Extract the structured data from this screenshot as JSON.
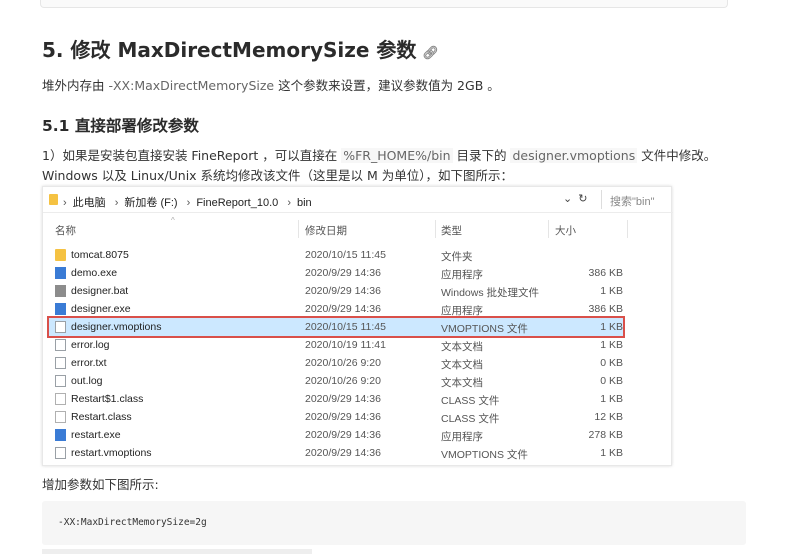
{
  "section": {
    "heading": "5. 修改 MaxDirectMemorySize 参数",
    "anchor_icon": "link-icon",
    "desc_prefix": "堆外内存由 ",
    "desc_code": "-XX:MaxDirectMemorySize",
    "desc_suffix": " 这个参数来设置，建议参数值为 2GB 。"
  },
  "subsection": {
    "heading": "5.1 直接部署修改参数",
    "para_1": "1）如果是安装包直接安装 FineReport ，可以直接在 ",
    "code_1": "%FR_HOME%/bin",
    "para_2": " 目录下的 ",
    "code_2": "designer.vmoptions",
    "para_3": " 文件中修改。Windows 以及 Linux/Unix 系统均修改该文件（这里是以 M 为单位），如下图所示："
  },
  "explorer": {
    "breadcrumb": [
      "此电脑",
      "新加卷 (F:)",
      "FineReport_10.0",
      "bin"
    ],
    "dropdown_icon": "chevron-down-icon",
    "refresh_icon": "refresh-icon",
    "search_placeholder": "搜索\"bin\"",
    "columns": {
      "name": "名称",
      "date": "修改日期",
      "type": "类型",
      "size": "大小"
    },
    "files": [
      {
        "name": "tomcat.8075",
        "date": "2020/10/15 11:45",
        "type": "文件夹",
        "size": "",
        "icon": "folder-icon"
      },
      {
        "name": "demo.exe",
        "date": "2020/9/29 14:36",
        "type": "应用程序",
        "size": "386 KB",
        "icon": "exe-icon"
      },
      {
        "name": "designer.bat",
        "date": "2020/9/29 14:36",
        "type": "Windows 批处理文件",
        "size": "1 KB",
        "icon": "bat-icon"
      },
      {
        "name": "designer.exe",
        "date": "2020/9/29 14:36",
        "type": "应用程序",
        "size": "386 KB",
        "icon": "exe-icon"
      },
      {
        "name": "designer.vmoptions",
        "date": "2020/10/15 11:45",
        "type": "VMOPTIONS 文件",
        "size": "1 KB",
        "icon": "document-icon",
        "selected": true
      },
      {
        "name": "error.log",
        "date": "2020/10/19 11:41",
        "type": "文本文档",
        "size": "1 KB",
        "icon": "document-icon"
      },
      {
        "name": "error.txt",
        "date": "2020/10/26 9:20",
        "type": "文本文档",
        "size": "0 KB",
        "icon": "document-icon"
      },
      {
        "name": "out.log",
        "date": "2020/10/26 9:20",
        "type": "文本文档",
        "size": "0 KB",
        "icon": "document-icon"
      },
      {
        "name": "Restart$1.class",
        "date": "2020/9/29 14:36",
        "type": "CLASS 文件",
        "size": "1 KB",
        "icon": "class-file-icon"
      },
      {
        "name": "Restart.class",
        "date": "2020/9/29 14:36",
        "type": "CLASS 文件",
        "size": "12 KB",
        "icon": "class-file-icon"
      },
      {
        "name": "restart.exe",
        "date": "2020/9/29 14:36",
        "type": "应用程序",
        "size": "278 KB",
        "icon": "exe-icon"
      },
      {
        "name": "restart.vmoptions",
        "date": "2020/9/29 14:36",
        "type": "VMOPTIONS 文件",
        "size": "1 KB",
        "icon": "document-icon"
      }
    ],
    "highlight_color": "#d9504a",
    "selection_color": "#cce8ff"
  },
  "after_image": {
    "text": "增加参数如下图所示:",
    "code": "-XX:MaxDirectMemorySize=2g"
  }
}
